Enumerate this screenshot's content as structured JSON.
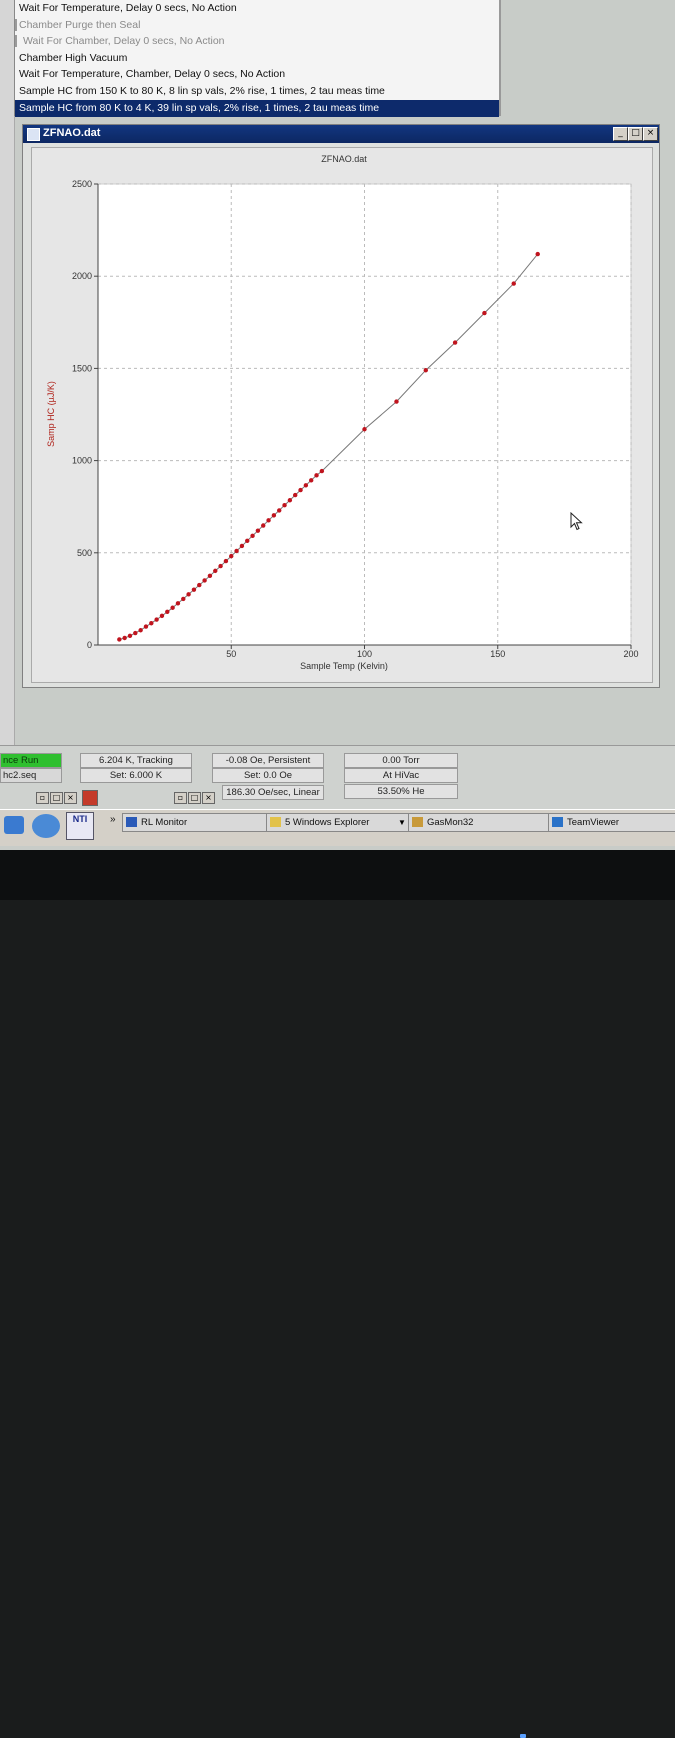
{
  "sequence": {
    "items": [
      {
        "label": "Wait For Temperature, Delay 0 secs, No Action",
        "state": "normal"
      },
      {
        "label": "Chamber Purge then Seal",
        "state": "dim"
      },
      {
        "label": "Wait For Chamber, Delay 0 secs, No Action",
        "state": "dim"
      },
      {
        "label": "Chamber High Vacuum",
        "state": "normal"
      },
      {
        "label": "Wait For Temperature, Chamber, Delay 0 secs, No Action",
        "state": "normal"
      },
      {
        "label": "Sample HC from 150 K to 80 K, 8 lin sp vals, 2% rise, 1 times, 2 tau meas time",
        "state": "normal"
      },
      {
        "label": "Sample HC from 80 K to 4 K, 39 lin sp vals, 2% rise, 1 times, 2 tau meas time",
        "state": "selected"
      }
    ]
  },
  "graph_window": {
    "title": "ZFNAO.dat",
    "plot_title": "ZFNAO.dat",
    "min_btn": "_",
    "max_btn": "□",
    "close_btn": "×"
  },
  "chart_data": {
    "type": "scatter",
    "title": "ZFNAO.dat",
    "xlabel": "Sample Temp (Kelvin)",
    "ylabel": "Samp HC (µJ/K)",
    "xlim": [
      0,
      200
    ],
    "ylim": [
      0,
      2500
    ],
    "xticks": [
      "50",
      "100",
      "150",
      "200"
    ],
    "yticks": [
      "0",
      "500",
      "1000",
      "1500",
      "2000",
      "2500"
    ],
    "grid": true,
    "marker_color": "#c0141e",
    "line_color": "#777777",
    "series": [
      {
        "points": [
          [
            8,
            30
          ],
          [
            10,
            38
          ],
          [
            12,
            50
          ],
          [
            14,
            65
          ],
          [
            16,
            80
          ],
          [
            18,
            100
          ],
          [
            20,
            118
          ],
          [
            22,
            138
          ],
          [
            24,
            158
          ],
          [
            26,
            180
          ],
          [
            28,
            202
          ],
          [
            30,
            226
          ],
          [
            32,
            250
          ],
          [
            34,
            275
          ],
          [
            36,
            300
          ],
          [
            38,
            325
          ],
          [
            40,
            350
          ],
          [
            42,
            375
          ],
          [
            44,
            402
          ],
          [
            46,
            428
          ],
          [
            48,
            455
          ],
          [
            50,
            482
          ],
          [
            52,
            510
          ],
          [
            54,
            537
          ],
          [
            56,
            565
          ],
          [
            58,
            592
          ],
          [
            60,
            620
          ],
          [
            62,
            648
          ],
          [
            64,
            676
          ],
          [
            66,
            703
          ],
          [
            68,
            730
          ],
          [
            70,
            758
          ],
          [
            72,
            785
          ],
          [
            74,
            813
          ],
          [
            76,
            840
          ],
          [
            78,
            866
          ],
          [
            80,
            893
          ],
          [
            82,
            920
          ],
          [
            84,
            943
          ],
          [
            100,
            1170
          ],
          [
            112,
            1320
          ],
          [
            123,
            1490
          ],
          [
            134,
            1640
          ],
          [
            145,
            1800
          ],
          [
            156,
            1960
          ],
          [
            165,
            2120
          ]
        ]
      }
    ]
  },
  "status": {
    "run_label": "nce Run",
    "seq_file": "hc2.seq",
    "temp_value": "6.204 K, Tracking",
    "temp_set": "Set: 6.000 K",
    "field_value": "-0.08 Oe, Persistent",
    "field_set": "Set: 0.0 Oe",
    "field_rate": "186.30 Oe/sec, Linear",
    "pressure_value": "0.00 Torr",
    "vacuum_state": "At HiVac",
    "helium_level": "53.50% He"
  },
  "taskbar": {
    "rl_monitor": "RL Monitor",
    "explorer": "5 Windows Explorer",
    "gasmon": "GasMon32",
    "teamviewer": "TeamViewer",
    "nti_label": "NTI",
    "chevron": "»"
  }
}
